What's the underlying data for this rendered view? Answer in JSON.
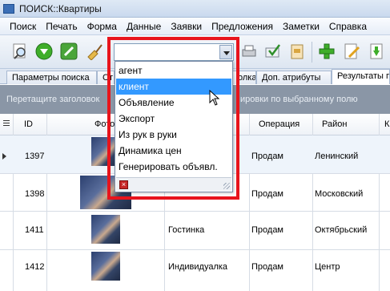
{
  "window": {
    "title": "ПОИСК::Квартиры"
  },
  "menu": [
    "Поиск",
    "Печать",
    "Форма",
    "Данные",
    "Заявки",
    "Предложения",
    "Заметки",
    "Справка"
  ],
  "tabs": [
    "Параметры поиска",
    "Ст",
    "олка",
    "Доп. атрибуты",
    "Результаты п"
  ],
  "group_hint": {
    "left": "Перетащите заголовок",
    "right": "ировки по выбранному полю"
  },
  "grid": {
    "columns": [
      "ID",
      "Фото",
      "Операция",
      "Район",
      "К"
    ],
    "rows": [
      {
        "id": "1397",
        "text": "",
        "operation": "Продам",
        "district": "Ленинский"
      },
      {
        "id": "1398",
        "text": "",
        "operation": "Продам",
        "district": "Московский"
      },
      {
        "id": "1411",
        "text": "Гостинка",
        "operation": "Продам",
        "district": "Октябрьский"
      },
      {
        "id": "1412",
        "text": "Индивидуалка",
        "operation": "Продам",
        "district": "Центр"
      }
    ]
  },
  "dropdown": {
    "items": [
      "агент",
      "клиент",
      "Объявление",
      "Экспорт",
      "Из рук в руки",
      "Динамика цен",
      "Генерировать объявл."
    ],
    "selected_index": 1
  },
  "colors": {
    "highlight": "#e8141c",
    "selection": "#3399ff",
    "group_bar": "#8a96a6"
  }
}
